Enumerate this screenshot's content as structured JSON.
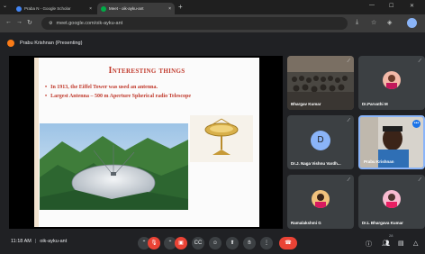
{
  "browser": {
    "tabs": [
      {
        "title": "Praba N - Google Scholar",
        "favicon_color": "#4285f4"
      },
      {
        "title": "Meet - oik-ayku-ant",
        "favicon_color": "#00ac47"
      }
    ],
    "new_tab_symbol": "+",
    "url": "meet.google.com/oik-ayku-ant"
  },
  "meet": {
    "presenter_label": "Prabu Krishnan (Presenting)"
  },
  "slide": {
    "title": "Interesting things",
    "bullets": [
      "In 1913, the Eiffel Tower was used an antenna.",
      "Largest Antenna – 500 m Aperture Spherical radio Telescope"
    ]
  },
  "participants": [
    {
      "name": "Bhargav Kumar",
      "kind": "video"
    },
    {
      "name": "Dr.Parvathi M",
      "kind": "photo"
    },
    {
      "name": "Dr.J. Naga Vishnu Vardh...",
      "kind": "letter",
      "letter": "D"
    },
    {
      "name": "Prabu Krishnan",
      "kind": "video",
      "speaking": true
    },
    {
      "name": "Ramalakshmi G",
      "kind": "photo"
    },
    {
      "name": "Dr.L Bhargava Kumar",
      "kind": "photo"
    }
  ],
  "bottom": {
    "time": "11:18 AM",
    "meeting_code": "oik-ayku-ant",
    "participant_count": "28"
  },
  "colors": {
    "accent": "#8ab4f8",
    "danger": "#ea4335",
    "slide_title": "#c0392b"
  }
}
